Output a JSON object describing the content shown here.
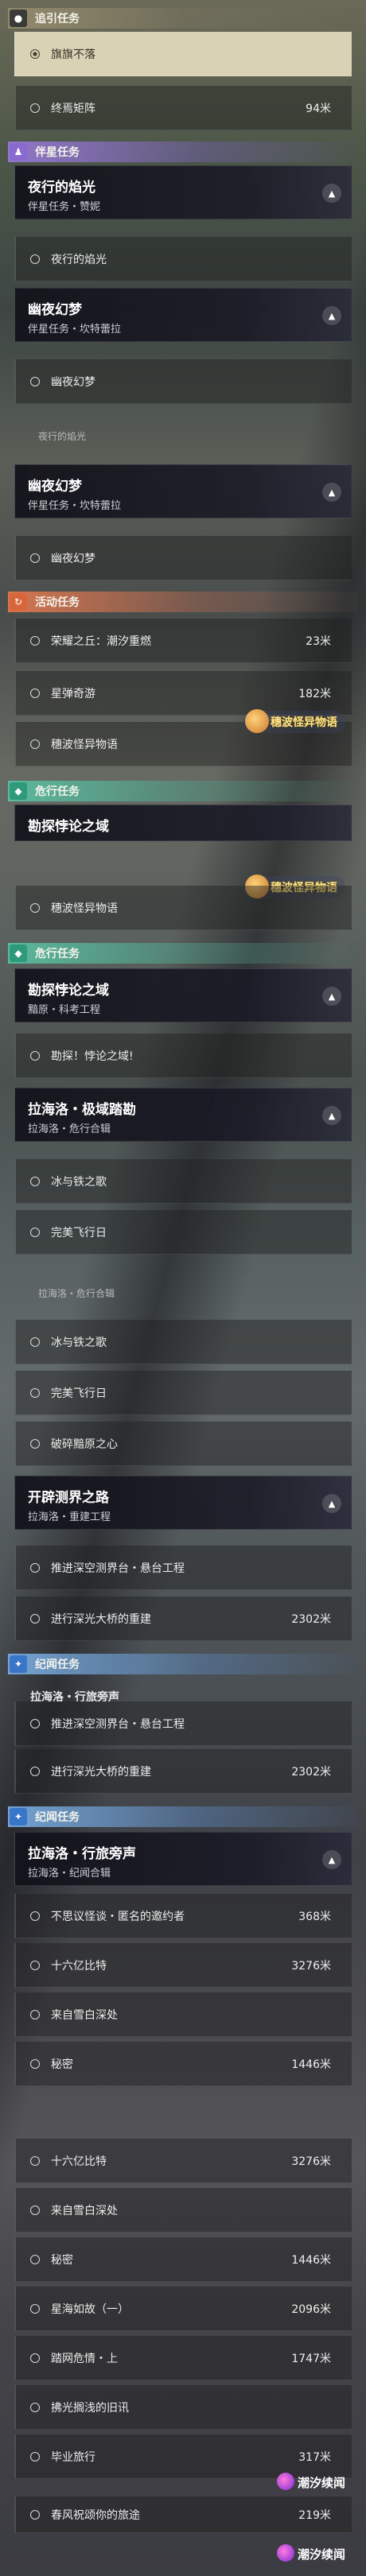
{
  "categories": {
    "guide": "追引任务",
    "companion": "伴星任务",
    "event": "活动任务",
    "risk": "危行任务",
    "chronicle": "纪闻任务"
  },
  "icons": {
    "guide": "location-pin-icon",
    "companion": "person-icon",
    "event": "spiral-icon",
    "risk": "diamond-icon",
    "chronicle": "sparkle-icon",
    "objective": "radio-circle-icon",
    "collapse": "chevron-up-icon"
  },
  "guide_objectives": [
    {
      "text": "旗旗不落",
      "dist": ""
    },
    {
      "text": "终焉矩阵",
      "dist": "94米"
    }
  ],
  "companion_tasks": [
    {
      "title": "夜行的焰光",
      "sub": "伴星任务・赞妮",
      "objective": "夜行的焰光"
    },
    {
      "title": "幽夜幻梦",
      "sub": "伴星任务・坎特蕾拉",
      "objective": "幽夜幻梦"
    }
  ],
  "fragment_text": "夜行的焰光",
  "repeat_companion": {
    "title": "幽夜幻梦",
    "sub": "伴星任务・坎特蕾拉",
    "objective": "幽夜幻梦"
  },
  "event_objectives": [
    {
      "text": "荣耀之丘：潮汐重燃",
      "dist": "23米"
    },
    {
      "text": "星弹奇游",
      "dist": "182米"
    },
    {
      "text": "穗波怪异物语",
      "dist": ""
    }
  ],
  "watermark_text": "穗波怪异物语",
  "risk_task_partial": {
    "title": "勘探悖论之域"
  },
  "risk_partial_objective": "穗波怪异物语",
  "risk_task": {
    "title": "勘探悖论之域",
    "sub": "黯原・科考工程",
    "objective": "勘探！悖论之域!"
  },
  "lahailuo_task": {
    "title": "拉海洛・极域踏勘",
    "sub": "拉海洛・危行合辑",
    "objectives": [
      "冰与铁之歌",
      "完美飞行日"
    ]
  },
  "lahailuo_frag": "拉海洛・危行合辑",
  "lahailuo_repeat_objectives": [
    "冰与铁之歌",
    "完美飞行日",
    "破碎黯原之心"
  ],
  "kaipi_task": {
    "title": "开辟测界之路",
    "sub": "拉海洛・重建工程"
  },
  "kaipi_objectives": [
    {
      "text": "推进深空测界台・悬台工程",
      "dist": ""
    },
    {
      "text": "进行深光大桥的重建",
      "dist": "2302米"
    }
  ],
  "chronicle_frag": "拉海洛・行旅旁声",
  "kaipi_repeat_objectives": [
    {
      "text": "推进深空测界台・悬台工程",
      "dist": ""
    },
    {
      "text": "进行深光大桥的重建",
      "dist": "2302米"
    }
  ],
  "chronicle_task": {
    "title": "拉海洛・行旅旁声",
    "sub": "拉海洛・纪闻合辑"
  },
  "chronicle_objectives": [
    {
      "text": "不思议怪谈・匿名的邀约者",
      "dist": "368米"
    },
    {
      "text": "十六亿比特",
      "dist": "3276米"
    },
    {
      "text": "来自雪白深处",
      "dist": ""
    },
    {
      "text": "秘密",
      "dist": "1446米"
    }
  ],
  "chronicle_objectives_2": [
    {
      "text": "十六亿比特",
      "dist": "3276米"
    },
    {
      "text": "来自雪白深处",
      "dist": ""
    },
    {
      "text": "秘密",
      "dist": "1446米"
    },
    {
      "text": "星海如故（一）",
      "dist": "2096米"
    },
    {
      "text": "踏网危情・上",
      "dist": "1747米"
    },
    {
      "text": "拂光搁浅的旧讯",
      "dist": ""
    },
    {
      "text": "毕业旅行",
      "dist": "317米"
    },
    {
      "text": "春风祝颂你的旅途",
      "dist": "219米"
    }
  ],
  "logo_text": "潮汐续闻"
}
